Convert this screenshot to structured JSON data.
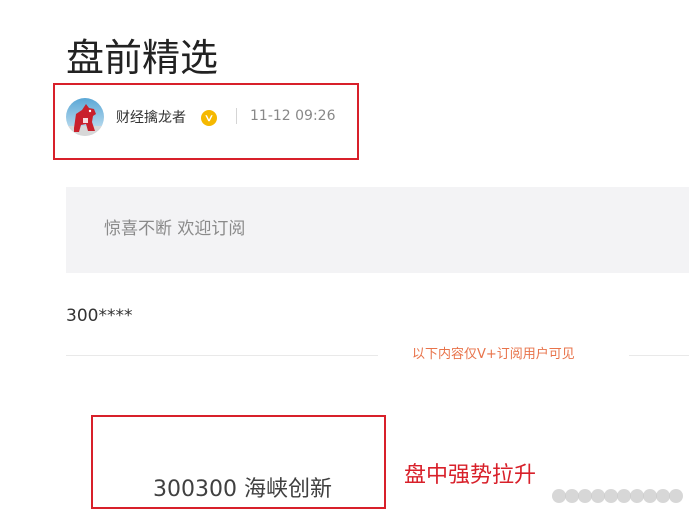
{
  "article": {
    "title": "盘前精选"
  },
  "author": {
    "name": "财经擒龙者",
    "verified_badge": "verified-v-icon",
    "post_time": "11-12 09:26",
    "avatar_icon": "red-horse-avatar-icon"
  },
  "subscribe_panel": {
    "text": "惊喜不断 欢迎订阅"
  },
  "content": {
    "stock_code_masked": "300****",
    "paywall_notice": "以下内容仅V+订阅用户可见",
    "stock_name": "300300 海峡创新",
    "annotation": "盘中强势拉升"
  },
  "colors": {
    "annotation_red": "#d8202a",
    "notice_orange": "#e8734a",
    "panel_gray": "#f3f3f5",
    "badge_gold": "#f5b800"
  }
}
